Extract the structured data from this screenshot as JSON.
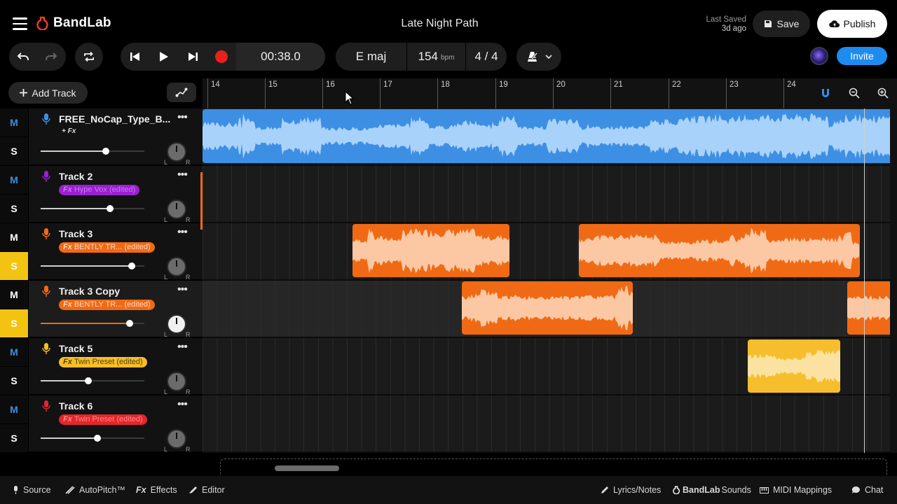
{
  "app": {
    "name": "BandLab",
    "project_title": "Late Night Path"
  },
  "header": {
    "last_saved_label": "Last Saved",
    "last_saved_ago": "3d ago",
    "save_label": "Save",
    "publish_label": "Publish",
    "invite_label": "Invite"
  },
  "transport": {
    "time": "00:38.0",
    "key": "E maj",
    "tempo": "154",
    "tempo_unit": "bpm",
    "time_signature": "4 / 4"
  },
  "toolbar": {
    "add_track_label": "Add Track"
  },
  "ruler": {
    "bars": [
      "14",
      "15",
      "16",
      "17",
      "18",
      "19",
      "20",
      "21",
      "22",
      "23",
      "24"
    ]
  },
  "tracks": [
    {
      "name": "FREE_NoCap_Type_B...",
      "fx": "+ Fx",
      "fx_style": "plain",
      "color": "#3d8fe4",
      "mute_label": "M",
      "solo_label": "S",
      "muted": false,
      "solo": false,
      "volume": 0.63,
      "pan_light": false
    },
    {
      "name": "Track 2",
      "fx": "Hype Vox (edited)",
      "fx_style": "tag",
      "color": "#9b1fd1",
      "mute_label": "M",
      "solo_label": "S",
      "muted": false,
      "solo": false,
      "volume": 0.67,
      "pan_light": false
    },
    {
      "name": "Track 3",
      "fx": "BENTLY TR... (edited)",
      "fx_style": "tag",
      "color": "#f06a15",
      "mute_label": "M",
      "solo_label": "S",
      "muted": true,
      "solo": true,
      "volume": 0.88,
      "pan_light": false
    },
    {
      "name": "Track 3 Copy",
      "fx": "BENTLY TR... (edited)",
      "fx_style": "tag",
      "color": "#f06a15",
      "mute_label": "M",
      "solo_label": "S",
      "muted": true,
      "solo": true,
      "volume": 0.86,
      "pan_light": true
    },
    {
      "name": "Track 5",
      "fx": "Twin Preset (edited)",
      "fx_style": "tag",
      "color": "#f6be2c",
      "mute_label": "M",
      "solo_label": "S",
      "muted": false,
      "solo": false,
      "volume": 0.46,
      "pan_light": false
    },
    {
      "name": "Track 6",
      "fx": "Twin Preset (edited)",
      "fx_style": "tag",
      "color": "#e3262b",
      "mute_label": "M",
      "solo_label": "S",
      "muted": false,
      "solo": false,
      "volume": 0.55,
      "pan_light": false
    }
  ],
  "fx_prefix": "Fx",
  "footer": {
    "source": "Source",
    "autopitch": "AutoPitch™",
    "effects": "Effects",
    "editor": "Editor",
    "lyrics": "Lyrics/Notes",
    "sounds_brand": "BandLab",
    "sounds": "Sounds",
    "midi": "MIDI Mappings",
    "chat": "Chat"
  },
  "icons": [
    "menu-icon",
    "bandlab-logo-icon",
    "save-icon",
    "cloud-upload-icon",
    "undo-icon",
    "redo-icon",
    "loop-icon",
    "skip-back-icon",
    "play-icon",
    "skip-forward-icon",
    "record-icon",
    "metronome-icon",
    "chevron-down-icon",
    "plus-icon",
    "automation-icon",
    "magnet-icon",
    "zoom-out-icon",
    "zoom-in-icon",
    "mic-icon",
    "more-icon",
    "pan-knob-icon",
    "lyrics-icon",
    "chat-icon"
  ]
}
